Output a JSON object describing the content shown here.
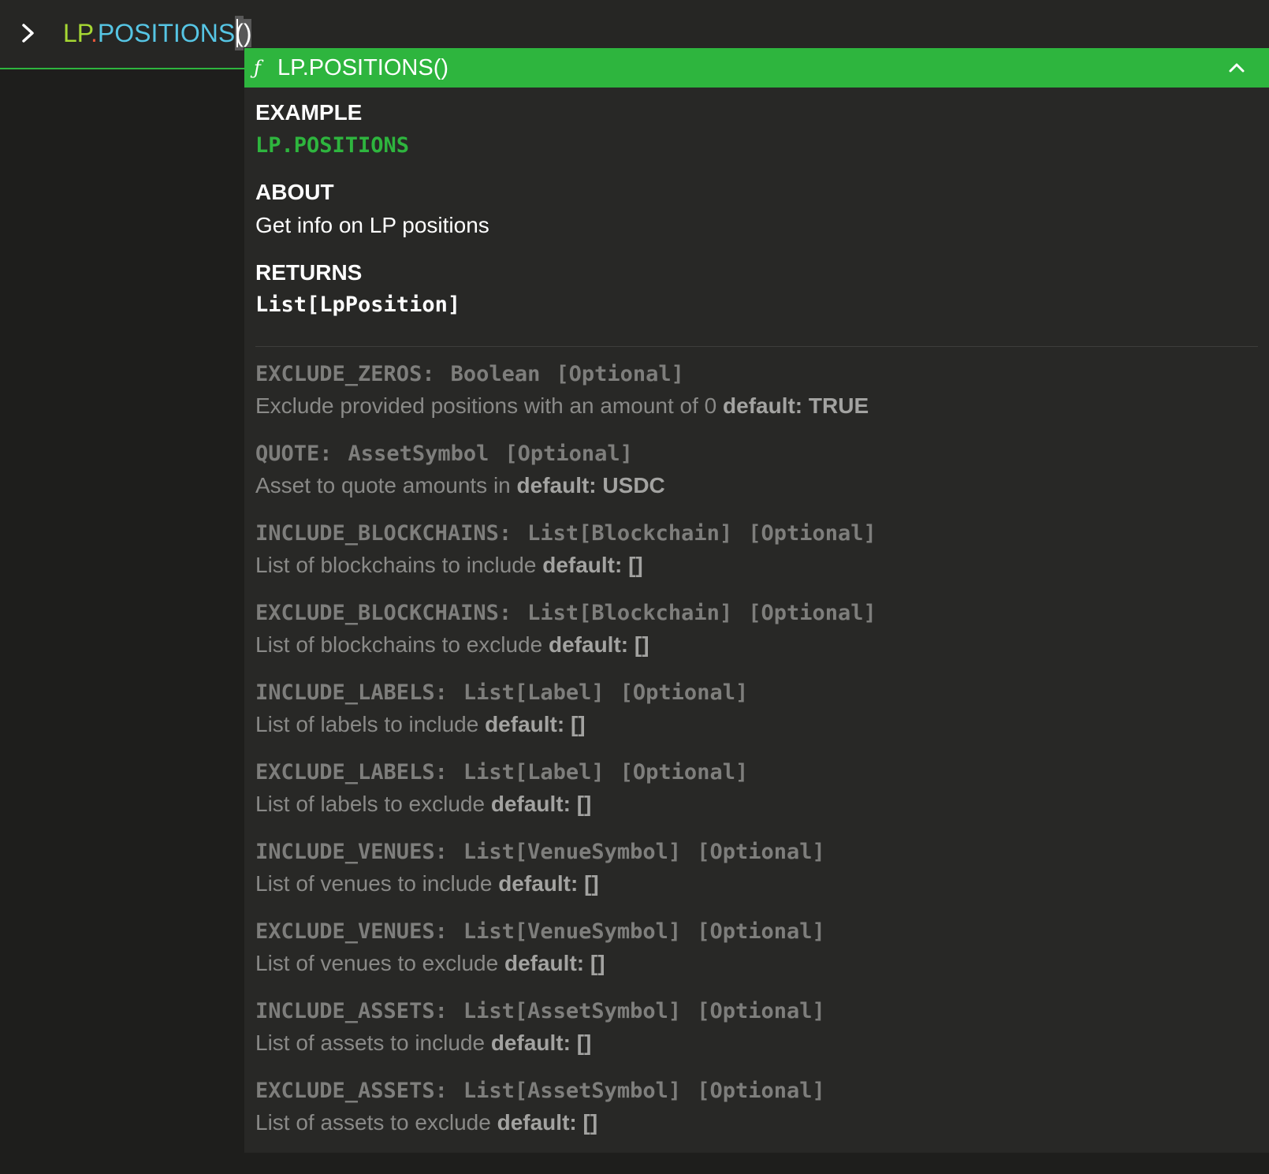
{
  "command": {
    "namespace": "LP",
    "dot": ".",
    "function": "POSITIONS",
    "paren_open": "(",
    "paren_close": ")",
    "prompt_icon": "chevron-right-icon"
  },
  "popup": {
    "header_icon": "function-icon",
    "header_icon_glyph": "ƒ",
    "title": "LP.POSITIONS()",
    "collapse_icon": "chevron-up-icon",
    "example_label": "EXAMPLE",
    "example_code": "LP.POSITIONS",
    "about_label": "ABOUT",
    "about_text": "Get info on LP positions",
    "returns_label": "RETURNS",
    "returns_type": "List[LpPosition]",
    "params": [
      {
        "name": "EXCLUDE_ZEROS:",
        "type": "Boolean",
        "optional": "[Optional]",
        "description": "Exclude provided positions with an amount of 0",
        "default_label": "default:",
        "default_value": "TRUE"
      },
      {
        "name": "QUOTE:",
        "type": "AssetSymbol",
        "optional": "[Optional]",
        "description": "Asset to quote amounts in",
        "default_label": "default:",
        "default_value": "USDC"
      },
      {
        "name": "INCLUDE_BLOCKCHAINS:",
        "type": "List[Blockchain]",
        "optional": "[Optional]",
        "description": "List of blockchains to include",
        "default_label": "default:",
        "default_value": "[]"
      },
      {
        "name": "EXCLUDE_BLOCKCHAINS:",
        "type": "List[Blockchain]",
        "optional": "[Optional]",
        "description": "List of blockchains to exclude",
        "default_label": "default:",
        "default_value": "[]"
      },
      {
        "name": "INCLUDE_LABELS:",
        "type": "List[Label]",
        "optional": "[Optional]",
        "description": "List of labels to include",
        "default_label": "default:",
        "default_value": "[]"
      },
      {
        "name": "EXCLUDE_LABELS:",
        "type": "List[Label]",
        "optional": "[Optional]",
        "description": "List of labels to exclude",
        "default_label": "default:",
        "default_value": "[]"
      },
      {
        "name": "INCLUDE_VENUES:",
        "type": "List[VenueSymbol]",
        "optional": "[Optional]",
        "description": "List of venues to include",
        "default_label": "default:",
        "default_value": "[]"
      },
      {
        "name": "EXCLUDE_VENUES:",
        "type": "List[VenueSymbol]",
        "optional": "[Optional]",
        "description": "List of venues to exclude",
        "default_label": "default:",
        "default_value": "[]"
      },
      {
        "name": "INCLUDE_ASSETS:",
        "type": "List[AssetSymbol]",
        "optional": "[Optional]",
        "description": "List of assets to include",
        "default_label": "default:",
        "default_value": "[]"
      },
      {
        "name": "EXCLUDE_ASSETS:",
        "type": "List[AssetSymbol]",
        "optional": "[Optional]",
        "description": "List of assets to exclude",
        "default_label": "default:",
        "default_value": "[]"
      }
    ]
  },
  "colors": {
    "accent_green": "#2eb53e",
    "namespace_token": "#a6d833",
    "dot_token": "#e4553b",
    "function_token": "#56c5e4",
    "background": "#1e1e1c",
    "popup_background": "#282826"
  }
}
